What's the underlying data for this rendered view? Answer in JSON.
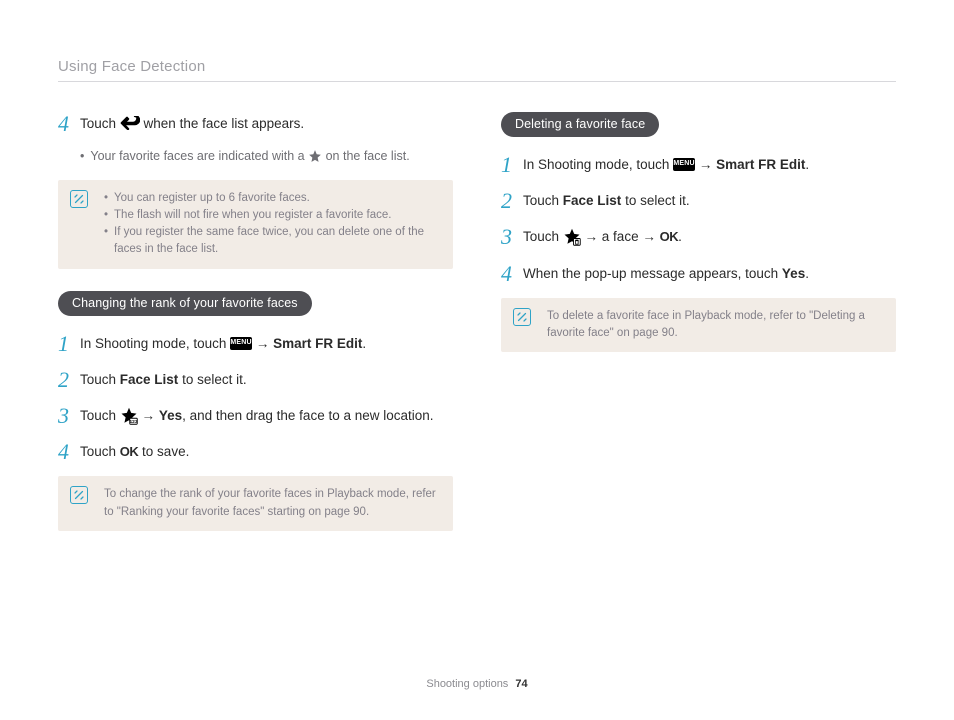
{
  "header": "Using Face Detection",
  "left": {
    "step4": {
      "num": "4",
      "text_a": "Touch ",
      "text_b": " when the face list appears."
    },
    "sub_bullet": {
      "a": "Your favorite faces are indicated with a ",
      "b": " on the face list."
    },
    "info1": {
      "li1": "You can register up to 6 favorite faces.",
      "li2": "The flash will not fire when you register a favorite face.",
      "li3": "If you register the same face twice, you can delete one of the faces in the face list."
    },
    "pill": "Changing the rank of your favorite faces",
    "s1": {
      "num": "1",
      "a": "In Shooting mode, touch ",
      "b": " → ",
      "c": "Smart FR Edit",
      "d": "."
    },
    "s2": {
      "num": "2",
      "a": "Touch ",
      "b": "Face List",
      "c": " to select it."
    },
    "s3": {
      "num": "3",
      "a": "Touch ",
      "b": " → ",
      "c": "Yes",
      "d": ", and then drag the face to a new location."
    },
    "s4": {
      "num": "4",
      "a": "Touch ",
      "b": " to save."
    },
    "info2": "To change the rank of your favorite faces in Playback mode, refer to \"Ranking your favorite faces\" starting on page 90."
  },
  "right": {
    "pill": "Deleting a favorite face",
    "s1": {
      "num": "1",
      "a": "In Shooting mode, touch ",
      "b": " → ",
      "c": "Smart FR Edit",
      "d": "."
    },
    "s2": {
      "num": "2",
      "a": "Touch ",
      "b": "Face List",
      "c": " to select it."
    },
    "s3": {
      "num": "3",
      "a": "Touch ",
      "b": " → a face → ",
      "c": "."
    },
    "s4": {
      "num": "4",
      "a": "When the pop-up message appears, touch ",
      "b": "Yes",
      "c": "."
    },
    "info": "To delete a favorite face in Playback mode, refer to \"Deleting a favorite face\" on page 90."
  },
  "footer": {
    "section": "Shooting options",
    "page": "74"
  },
  "icons": {
    "menu": "MENU",
    "ok": "OK"
  }
}
